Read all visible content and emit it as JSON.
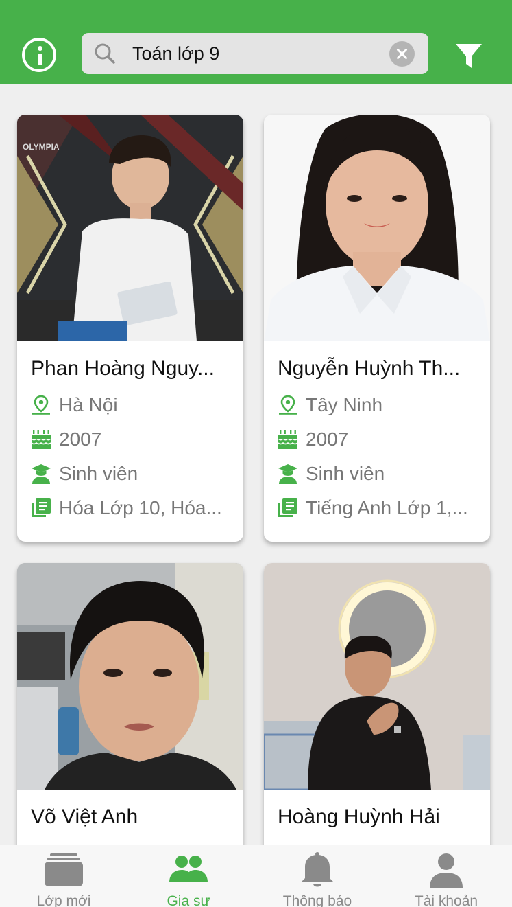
{
  "header": {
    "search_value": "Toán lớp 9",
    "accent_color": "#47b14a",
    "icons": [
      "info-icon",
      "search-icon",
      "clear-icon",
      "filter-icon"
    ]
  },
  "tutors": [
    {
      "name": "Phan Hoàng Nguy...",
      "location": "Hà Nội",
      "birth_year": "2007",
      "occupation": "Sinh viên",
      "subjects": "Hóa Lớp 10, Hóa...",
      "photo_caption": "OLYMPIA"
    },
    {
      "name": "Nguyễn Huỳnh Th...",
      "location": "Tây Ninh",
      "birth_year": "2007",
      "occupation": "Sinh viên",
      "subjects": "Tiếng Anh Lớp 1,..."
    },
    {
      "name": "Võ Việt Anh"
    },
    {
      "name": "Hoàng Huỳnh Hải"
    }
  ],
  "bottom_nav": {
    "items": [
      {
        "label": "Lớp mới",
        "icon": "stack-icon",
        "active": false
      },
      {
        "label": "Gia sư",
        "icon": "users-icon",
        "active": true
      },
      {
        "label": "Thông báo",
        "icon": "bell-icon",
        "active": false
      },
      {
        "label": "Tài khoản",
        "icon": "person-icon",
        "active": false
      }
    ]
  }
}
